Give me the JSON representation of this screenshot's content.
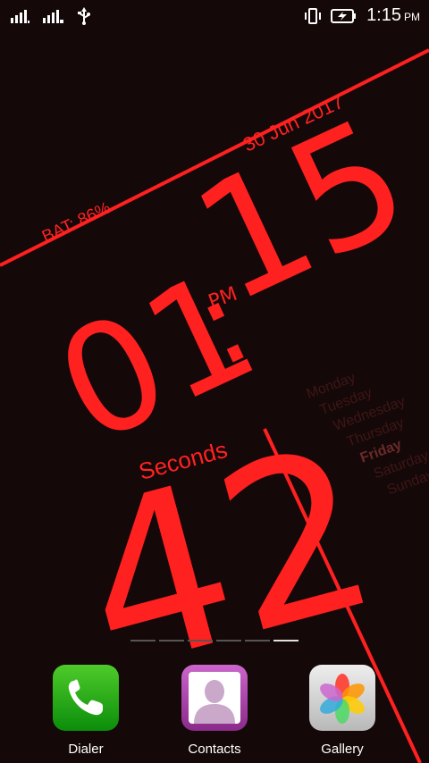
{
  "status_bar": {
    "time": "1:15",
    "ampm": "PM"
  },
  "clock": {
    "date": "30 Jun 2017",
    "battery": "BAT: 86%",
    "hours": "01",
    "minutes": "15",
    "ampm": "PM",
    "seconds_label": "Seconds",
    "seconds": "42"
  },
  "weekdays": [
    {
      "label": "Monday",
      "active": false
    },
    {
      "label": "Tuesday",
      "active": false
    },
    {
      "label": "Wednesday",
      "active": false
    },
    {
      "label": "Thursday",
      "active": false
    },
    {
      "label": "Friday",
      "active": true
    },
    {
      "label": "Saturday",
      "active": false
    },
    {
      "label": "Sunday",
      "active": false
    }
  ],
  "page_indicator": {
    "count": 6,
    "active_index": 5
  },
  "dock": [
    {
      "label": "Dialer",
      "icon": "phone-icon"
    },
    {
      "label": "Contacts",
      "icon": "person-icon"
    },
    {
      "label": "Gallery",
      "icon": "pinwheel-icon"
    }
  ],
  "colors": {
    "accent": "#ff2222",
    "background": "#150808",
    "weekday_dim": "#3e1616",
    "weekday_active": "#6a2a2a"
  }
}
